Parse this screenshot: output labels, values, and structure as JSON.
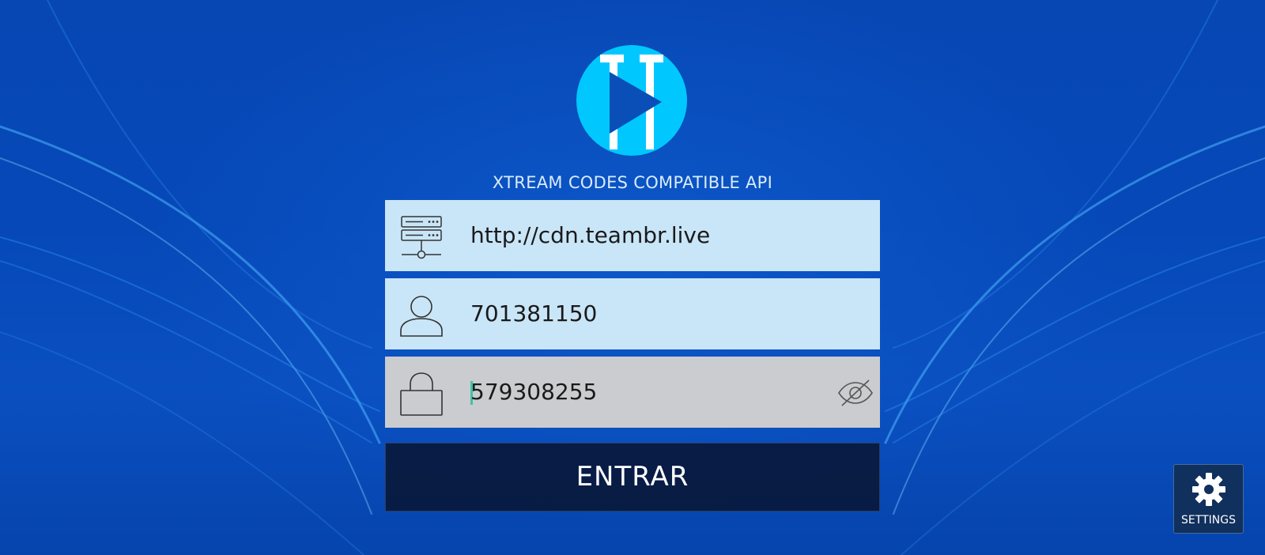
{
  "app": {
    "subtitle": "XTREAM CODES COMPATIBLE API"
  },
  "form": {
    "server_url": {
      "value": "http://cdn.teambr.live",
      "icon": "server-icon"
    },
    "username": {
      "value": "701381150",
      "icon": "user-icon"
    },
    "password": {
      "value": "579308255",
      "icon": "lock-icon",
      "toggle_icon": "eye-off-icon"
    },
    "submit_label": "ENTRAR"
  },
  "settings": {
    "label": "SETTINGS",
    "icon": "gear-icon"
  },
  "colors": {
    "background": "#0747b4",
    "logo_circle": "#00c8ff",
    "field_active": "#c9e6f8",
    "field_focused": "#cbcccf",
    "button": "#081634",
    "caret": "#3fc3a8"
  }
}
